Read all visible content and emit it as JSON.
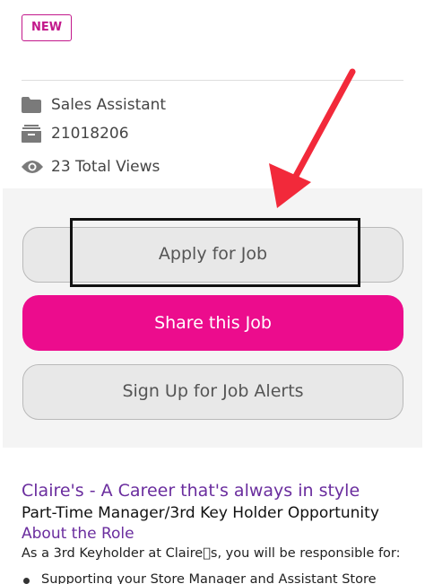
{
  "badge": {
    "label": "NEW"
  },
  "job_meta": [
    {
      "icon": "folder-icon",
      "text": "Sales Assistant"
    },
    {
      "icon": "archive-icon",
      "text": "21018206"
    },
    {
      "icon": "eye-icon",
      "text": "23 Total Views"
    }
  ],
  "actions": {
    "apply_label": "Apply for Job",
    "share_label": "Share this Job",
    "alerts_label": "Sign Up for Job Alerts"
  },
  "annotation": {
    "arrow_color": "#f2293a",
    "box_color": "#111111"
  },
  "about": {
    "title": "Claire's - A Career that's always in style",
    "subtitle": "Part-Time Manager/3rd Key Holder Opportunity",
    "heading": "About the Role",
    "intro": "As a 3rd Keyholder at Claire\u0000s, you will be responsible for:",
    "bullets": [
      "Supporting your Store Manager and Assistant Store"
    ]
  },
  "colors": {
    "brand_pink": "#ec0c8d",
    "accent_purple": "#6a2d9e",
    "badge_magenta": "#c2188b"
  }
}
